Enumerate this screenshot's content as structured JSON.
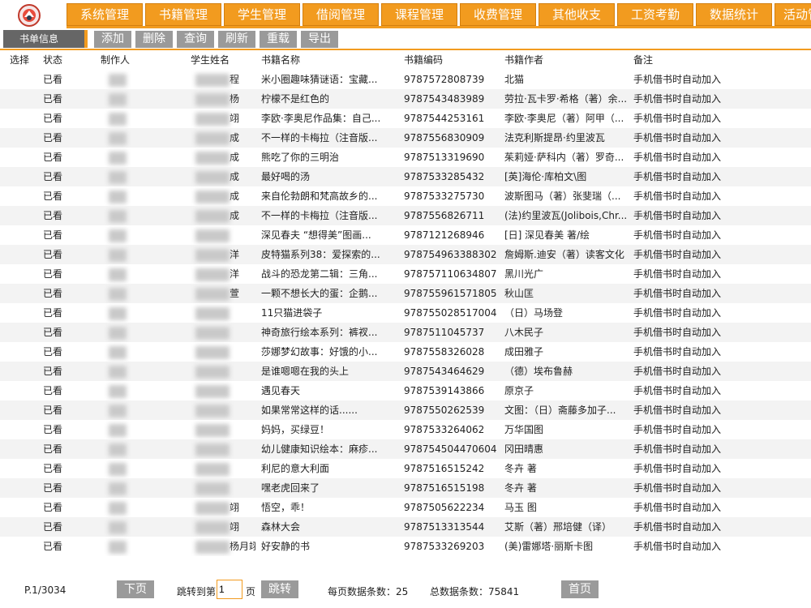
{
  "nav": {
    "items": [
      "系统管理",
      "书籍管理",
      "学生管理",
      "借阅管理",
      "课程管理",
      "收费管理",
      "其他收支",
      "工资考勤",
      "数据统计",
      "活动管"
    ]
  },
  "toolbar": {
    "tab_label": "书单信息",
    "buttons": [
      "添加",
      "删除",
      "查询",
      "刷新",
      "重载",
      "导出"
    ]
  },
  "table": {
    "columns": [
      "选择",
      "状态",
      "制作人",
      "学生姓名",
      "书籍名称",
      "书籍编码",
      "书籍作者",
      "备注"
    ],
    "rows": [
      {
        "status": "已看",
        "maker": "",
        "student": "程",
        "title": "米小圈趣味猜谜语：宝藏...",
        "code": "9787572808739",
        "author": "北猫",
        "note": "手机借书时自动加入"
      },
      {
        "status": "已看",
        "maker": "",
        "student": "杨",
        "title": "柠檬不是红色的",
        "code": "9787543483989",
        "author": "劳拉·瓦卡罗·希格（著）余...",
        "note": "手机借书时自动加入"
      },
      {
        "status": "已看",
        "maker": "",
        "student": "翊",
        "title": "李欧·李奥尼作品集：自己...",
        "code": "9787544253161",
        "author": "李欧·李奥尼（著）阿甲（...",
        "note": "手机借书时自动加入"
      },
      {
        "status": "已看",
        "maker": "",
        "student": "成",
        "title": "不一样的卡梅拉（注音版...",
        "code": "9787556830909",
        "author": "法克利斯提昂·约里波瓦",
        "note": "手机借书时自动加入"
      },
      {
        "status": "已看",
        "maker": "",
        "student": "成",
        "title": "熊吃了你的三明治",
        "code": "9787513319690",
        "author": "茱莉娅·萨科内（著）罗奇...",
        "note": "手机借书时自动加入"
      },
      {
        "status": "已看",
        "maker": "",
        "student": "成",
        "title": "最好喝的汤",
        "code": "9787533285432",
        "author": "[英]海伦·库柏文\\图",
        "note": "手机借书时自动加入"
      },
      {
        "status": "已看",
        "maker": "",
        "student": "成",
        "title": "来自伦勃朗和梵高故乡的...",
        "code": "9787533275730",
        "author": "波斯图马（著）张斐瑞（...",
        "note": "手机借书时自动加入"
      },
      {
        "status": "已看",
        "maker": "",
        "student": "成",
        "title": "不一样的卡梅拉（注音版...",
        "code": "9787556826711",
        "author": "(法)约里波瓦(Jolibois,Chr...",
        "note": "手机借书时自动加入"
      },
      {
        "status": "已看",
        "maker": "",
        "student": "",
        "title": "深见春夫 “想得美”图画...",
        "code": "9787121268946",
        "author": "[日] 深见春美 著/绘",
        "note": "手机借书时自动加入"
      },
      {
        "status": "已看",
        "maker": "",
        "student": "洋",
        "title": "皮特猫系列38：爱探索的...",
        "code": "978754963388302",
        "author": "詹姆斯.迪安（著）读客文化",
        "note": "手机借书时自动加入"
      },
      {
        "status": "已看",
        "maker": "",
        "student": "洋",
        "title": "战斗的恐龙第二辑：三角...",
        "code": "978757110634807",
        "author": "黑川光广",
        "note": "手机借书时自动加入"
      },
      {
        "status": "已看",
        "maker": "",
        "student": "萱",
        "title": "一颗不想长大的蛋：企鹅...",
        "code": "978755961571805",
        "author": "秋山匡",
        "note": "手机借书时自动加入"
      },
      {
        "status": "已看",
        "maker": "",
        "student": "",
        "title": "11只猫进袋子",
        "code": "978755028517004",
        "author": "（日）马场登",
        "note": "手机借书时自动加入"
      },
      {
        "status": "已看",
        "maker": "",
        "student": "",
        "title": "神奇旅行绘本系列：裤衩...",
        "code": "9787511045737",
        "author": "八木民子",
        "note": "手机借书时自动加入"
      },
      {
        "status": "已看",
        "maker": "",
        "student": "",
        "title": "莎娜梦幻故事：好饿的小...",
        "code": "9787558326028",
        "author": "成田雅子",
        "note": "手机借书时自动加入"
      },
      {
        "status": "已看",
        "maker": "",
        "student": "",
        "title": "是谁嗯嗯在我的头上",
        "code": "9787543464629",
        "author": "（德）埃布鲁赫",
        "note": "手机借书时自动加入"
      },
      {
        "status": "已看",
        "maker": "",
        "student": "",
        "title": "遇见春天",
        "code": "9787539143866",
        "author": "原京子",
        "note": "手机借书时自动加入"
      },
      {
        "status": "已看",
        "maker": "",
        "student": "",
        "title": "如果常常这样的话......",
        "code": "9787550262539",
        "author": "文图：（日）斋藤多加子...",
        "note": "手机借书时自动加入"
      },
      {
        "status": "已看",
        "maker": "",
        "student": "",
        "title": "妈妈，买绿豆！",
        "code": "9787533264062",
        "author": "万华国图",
        "note": "手机借书时自动加入"
      },
      {
        "status": "已看",
        "maker": "",
        "student": "",
        "title": "幼儿健康知识绘本：麻疹...",
        "code": "978754504470604",
        "author": "冈田晴惠",
        "note": "手机借书时自动加入"
      },
      {
        "status": "已看",
        "maker": "",
        "student": "",
        "title": "利尼的意大利面",
        "code": "9787516515242",
        "author": "冬卉 著",
        "note": "手机借书时自动加入"
      },
      {
        "status": "已看",
        "maker": "",
        "student": "",
        "title": "嘿老虎回来了",
        "code": "9787516515198",
        "author": "冬卉 著",
        "note": "手机借书时自动加入"
      },
      {
        "status": "已看",
        "maker": "",
        "student": "翊",
        "title": "悟空，乖！",
        "code": "9787505622234",
        "author": "马玉 图",
        "note": "手机借书时自动加入"
      },
      {
        "status": "已看",
        "maker": "",
        "student": "翊",
        "title": "森林大会",
        "code": "9787513313544",
        "author": "艾斯（著）邢培健（译）",
        "note": "手机借书时自动加入"
      },
      {
        "status": "已看",
        "maker": "",
        "student": "杨月翊",
        "title": "好安静的书",
        "code": "9787533269203",
        "author": "(美)雷娜塔·丽斯卡图",
        "note": "手机借书时自动加入"
      }
    ]
  },
  "footer": {
    "page_indicator": "P.1/3034",
    "next_label": "下页",
    "jump_label": "跳转到第",
    "jump_value": "1",
    "jump_unit": "页",
    "go_label": "跳转",
    "per_page": "每页数据条数：25",
    "total": "总数据条数：75841",
    "first_label": "首页"
  },
  "colors": {
    "accent": "#f29b1f",
    "button_gray": "#9a9a9a",
    "tab_gray": "#666666"
  }
}
